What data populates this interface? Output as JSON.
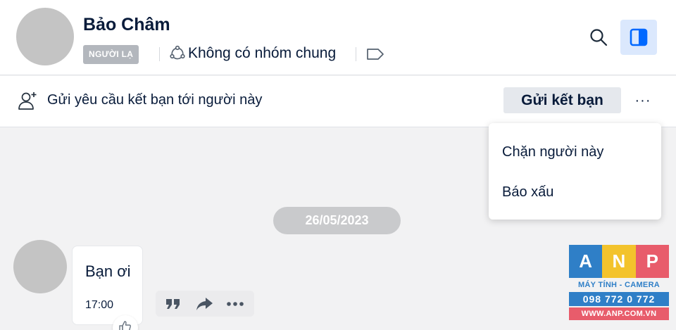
{
  "header": {
    "name": "Bảo Châm",
    "badge": "NGƯỜI LẠ",
    "groups_text": "Không có nhóm chung",
    "icons": {
      "group": "group-icon",
      "tag": "tag-icon",
      "search": "search-icon",
      "panel": "side-panel-icon"
    },
    "accent_color": "#0068ff",
    "panel_bg": "#dbe8fd"
  },
  "request_bar": {
    "text": "Gửi yêu cầu kết bạn tới người này",
    "button": "Gửi kết bạn",
    "more": "···",
    "icon": "add-user-icon"
  },
  "menu": {
    "items": [
      {
        "label": "Chặn người này"
      },
      {
        "label": "Báo xấu"
      }
    ]
  },
  "chat": {
    "date": "26/05/2023",
    "messages": [
      {
        "text": "Bạn ơi",
        "time": "17:00"
      }
    ],
    "actions": [
      "quote-icon",
      "share-icon",
      "more-icon"
    ],
    "reaction_icon": "thumbs-up-icon"
  },
  "watermark": {
    "letters": [
      "A",
      "N",
      "P"
    ],
    "letter_colors": [
      "#2f7fc7",
      "#f3c32c",
      "#e85c6b"
    ],
    "tagline": "MÁY TÍNH - CAMERA",
    "phone": "098 772 0 772",
    "website": "WWW.ANP.COM.VN"
  }
}
